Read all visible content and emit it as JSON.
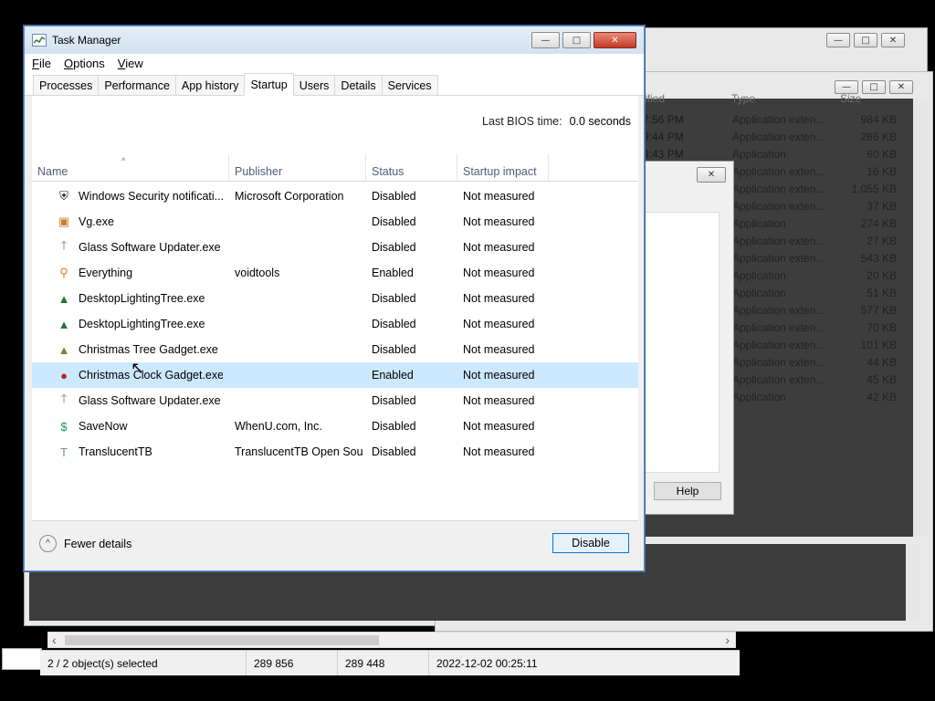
{
  "background": {
    "win1": {
      "caption_buttons": [
        "—",
        "□",
        "✕"
      ]
    },
    "win2": {
      "caption_buttons": [
        "—",
        "□",
        "✕"
      ],
      "partial_rows": [
        {
          "modified": "7:56 PM",
          "type": "Application exten...",
          "size": "984 KB"
        },
        {
          "modified": "9:44 PM",
          "type": "Application exten...",
          "size": "266 KB"
        },
        {
          "modified": "8:43 PM",
          "type": "Application",
          "size": "60 KB"
        },
        {
          "modified": "",
          "type": "Application exten...",
          "size": "16 KB"
        },
        {
          "modified": "",
          "type": "Application exten...",
          "size": "1,055 KB"
        },
        {
          "modified": "",
          "type": "Application exten...",
          "size": "37 KB"
        },
        {
          "modified": "",
          "type": "Application",
          "size": "274 KB"
        },
        {
          "modified": "",
          "type": "Application exten...",
          "size": "27 KB"
        },
        {
          "modified": "",
          "type": "Application exten...",
          "size": "543 KB"
        },
        {
          "modified": "",
          "type": "Application",
          "size": "20 KB"
        },
        {
          "modified": "",
          "type": "Application",
          "size": "51 KB"
        },
        {
          "modified": "",
          "type": "Application exten...",
          "size": "577 KB"
        },
        {
          "modified": "",
          "type": "Application exten...",
          "size": "70 KB"
        },
        {
          "modified": "",
          "type": "Application exten...",
          "size": "101 KB"
        },
        {
          "modified": "",
          "type": "Application exten...",
          "size": "44 KB"
        },
        {
          "modified": "",
          "type": "Application exten...",
          "size": "45 KB"
        },
        {
          "modified": "",
          "type": "Application",
          "size": "42 KB"
        }
      ],
      "header": {
        "modified": "ified",
        "type": "Type",
        "size": "Size"
      }
    },
    "dialog": {
      "help_label": "Help",
      "close_glyph": "✕"
    },
    "statusbar": {
      "selection": "2 / 2 object(s) selected",
      "size1": "289 856",
      "size2": "289 448",
      "datetime": "2022-12-02 00:25:11"
    },
    "hscroll": {
      "left_arrow": "‹",
      "right_arrow": "›"
    }
  },
  "task_manager": {
    "title": "Task Manager",
    "caption_buttons": [
      "—",
      "□",
      "✕"
    ],
    "menu": [
      {
        "label_u": "F",
        "label_rest": "ile"
      },
      {
        "label_u": "O",
        "label_rest": "ptions"
      },
      {
        "label_u": "V",
        "label_rest": "iew"
      }
    ],
    "tabs": [
      "Processes",
      "Performance",
      "App history",
      "Startup",
      "Users",
      "Details",
      "Services"
    ],
    "active_tab": "Startup",
    "bios_label": "Last BIOS time:",
    "bios_value": "0.0 seconds",
    "columns": {
      "name": "Name",
      "publisher": "Publisher",
      "status": "Status",
      "impact": "Startup impact"
    },
    "sort_caret": "^",
    "rows": [
      {
        "icon": "shield-icon",
        "glyph": "⛨",
        "color": "#222",
        "name": "Windows Security notificati...",
        "publisher": "Microsoft Corporation",
        "status": "Disabled",
        "impact": "Not measured"
      },
      {
        "icon": "vg-icon",
        "glyph": "▣",
        "color": "#c77b2a",
        "name": "Vg.exe",
        "publisher": "",
        "status": "Disabled",
        "impact": "Not measured"
      },
      {
        "icon": "up-arrow-icon",
        "glyph": "🡑",
        "color": "#777",
        "name": "Glass Software Updater.exe",
        "publisher": "",
        "status": "Disabled",
        "impact": "Not measured"
      },
      {
        "icon": "magnifier-icon",
        "glyph": "⚲",
        "color": "#e07a14",
        "name": "Everything",
        "publisher": "voidtools",
        "status": "Enabled",
        "impact": "Not measured"
      },
      {
        "icon": "tree-icon",
        "glyph": "▲",
        "color": "#1f7a2c",
        "name": "DesktopLightingTree.exe",
        "publisher": "",
        "status": "Disabled",
        "impact": "Not measured"
      },
      {
        "icon": "tree-icon",
        "glyph": "▲",
        "color": "#1f7a2c",
        "name": "DesktopLightingTree.exe",
        "publisher": "",
        "status": "Disabled",
        "impact": "Not measured"
      },
      {
        "icon": "xmas-tree-icon",
        "glyph": "▲",
        "color": "#8a7a2a",
        "name": "Christmas Tree Gadget.exe",
        "publisher": "",
        "status": "Disabled",
        "impact": "Not measured"
      },
      {
        "icon": "ornament-icon",
        "glyph": "●",
        "color": "#b3261e",
        "name": "Christmas Clock Gadget.exe",
        "publisher": "",
        "status": "Enabled",
        "impact": "Not measured",
        "selected": true
      },
      {
        "icon": "up-arrow-icon",
        "glyph": "🡑",
        "color": "#777",
        "name": "Glass Software Updater.exe",
        "publisher": "",
        "status": "Disabled",
        "impact": "Not measured"
      },
      {
        "icon": "dollar-icon",
        "glyph": "$",
        "color": "#1b9a3a",
        "name": "SaveNow",
        "publisher": "WhenU.com, Inc.",
        "status": "Disabled",
        "impact": "Not measured"
      },
      {
        "icon": "translucenttb-icon",
        "glyph": "T",
        "color": "#6aa36a",
        "name": "TranslucentTB",
        "publisher": "TranslucentTB Open Sou...",
        "status": "Disabled",
        "impact": "Not measured"
      }
    ],
    "fewer_details": "Fewer details",
    "fewer_details_u": "d",
    "chevron_glyph": "^",
    "disable_label": "Disable",
    "cursor_glyph": "↖"
  }
}
